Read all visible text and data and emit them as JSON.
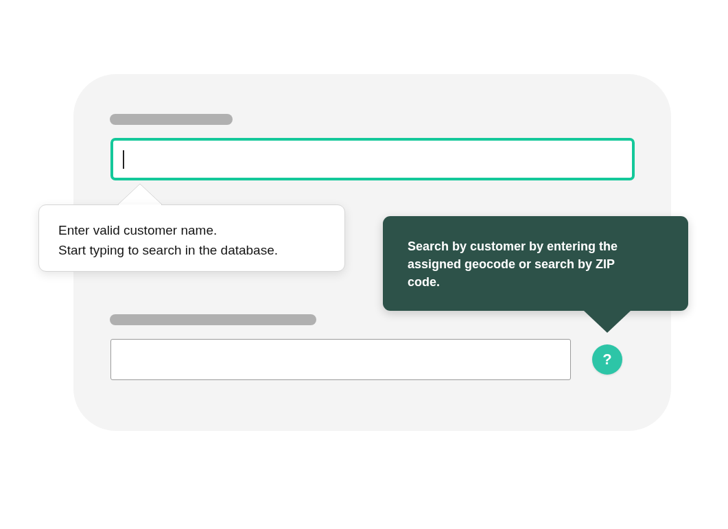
{
  "form": {
    "fields": [
      {
        "focused": true,
        "hint_lines": [
          "Enter valid customer name.",
          "Start typing to search in the database."
        ]
      },
      {
        "focused": false,
        "help_button": "?",
        "help_tooltip": "Search by customer by entering the assigned geocode or search by ZIP code."
      }
    ]
  }
}
